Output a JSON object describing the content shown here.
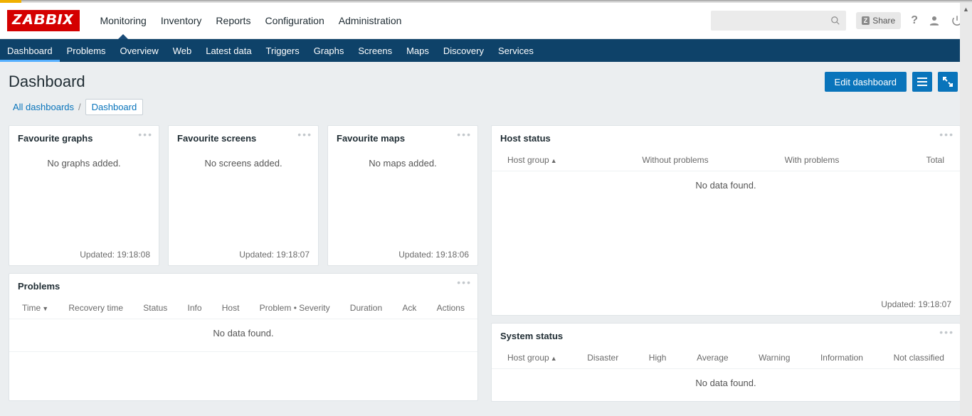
{
  "logo": "ZABBIX",
  "mainnav": {
    "items": [
      {
        "label": "Monitoring",
        "active": true
      },
      {
        "label": "Inventory"
      },
      {
        "label": "Reports"
      },
      {
        "label": "Configuration"
      },
      {
        "label": "Administration"
      }
    ]
  },
  "share_label": "Share",
  "subnav": {
    "items": [
      {
        "label": "Dashboard",
        "active": true
      },
      {
        "label": "Problems"
      },
      {
        "label": "Overview"
      },
      {
        "label": "Web"
      },
      {
        "label": "Latest data"
      },
      {
        "label": "Triggers"
      },
      {
        "label": "Graphs"
      },
      {
        "label": "Screens"
      },
      {
        "label": "Maps"
      },
      {
        "label": "Discovery"
      },
      {
        "label": "Services"
      }
    ]
  },
  "page_title": "Dashboard",
  "edit_label": "Edit dashboard",
  "breadcrumb": {
    "root": "All dashboards",
    "current": "Dashboard"
  },
  "widgets": {
    "fav_graphs": {
      "title": "Favourite graphs",
      "empty": "No graphs added.",
      "updated": "Updated: 19:18:08"
    },
    "fav_screens": {
      "title": "Favourite screens",
      "empty": "No screens added.",
      "updated": "Updated: 19:18:07"
    },
    "fav_maps": {
      "title": "Favourite maps",
      "empty": "No maps added.",
      "updated": "Updated: 19:18:06"
    },
    "problems": {
      "title": "Problems",
      "cols": {
        "time": "Time",
        "recovery": "Recovery time",
        "status": "Status",
        "info": "Info",
        "host": "Host",
        "problem": "Problem • Severity",
        "duration": "Duration",
        "ack": "Ack",
        "actions": "Actions"
      },
      "nodata": "No data found."
    },
    "hoststatus": {
      "title": "Host status",
      "cols": {
        "group": "Host group",
        "without": "Without problems",
        "with": "With problems",
        "total": "Total"
      },
      "nodata": "No data found.",
      "updated": "Updated: 19:18:07"
    },
    "sysstatus": {
      "title": "System status",
      "cols": {
        "group": "Host group",
        "disaster": "Disaster",
        "high": "High",
        "average": "Average",
        "warning": "Warning",
        "info": "Information",
        "notclass": "Not classified"
      },
      "nodata": "No data found."
    }
  }
}
